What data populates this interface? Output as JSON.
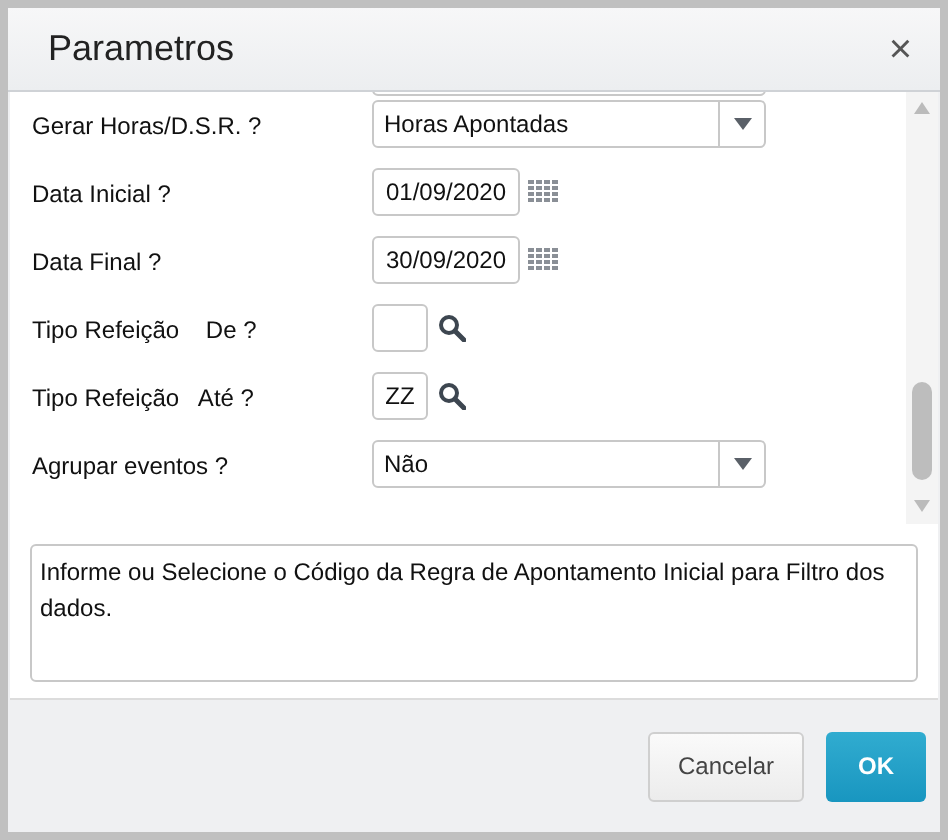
{
  "window": {
    "title": "Parametros",
    "close": "×"
  },
  "fields": [
    {
      "kind": "partial"
    },
    {
      "kind": "select",
      "label": "Gerar Horas/D.S.R. ?",
      "value": "Horas Apontadas"
    },
    {
      "kind": "date",
      "label": "Data Inicial ?",
      "value": "01/09/2020"
    },
    {
      "kind": "date",
      "label": "Data Final ?",
      "value": "30/09/2020"
    },
    {
      "kind": "lookup",
      "label": "Tipo Refeição    De ?"
    },
    {
      "kind": "lookup",
      "label": "Tipo Refeição   Até ?",
      "value": "ZZ"
    },
    {
      "kind": "select",
      "label": "Agrupar eventos ?",
      "value": "Não"
    }
  ],
  "help_text": "Informe ou Selecione o Código da Regra de Apontamento Inicial para Filtro dos dados.",
  "buttons": [
    {
      "label": "Cancelar",
      "kind": "secondary"
    },
    {
      "label": "OK",
      "kind": "primary"
    }
  ]
}
